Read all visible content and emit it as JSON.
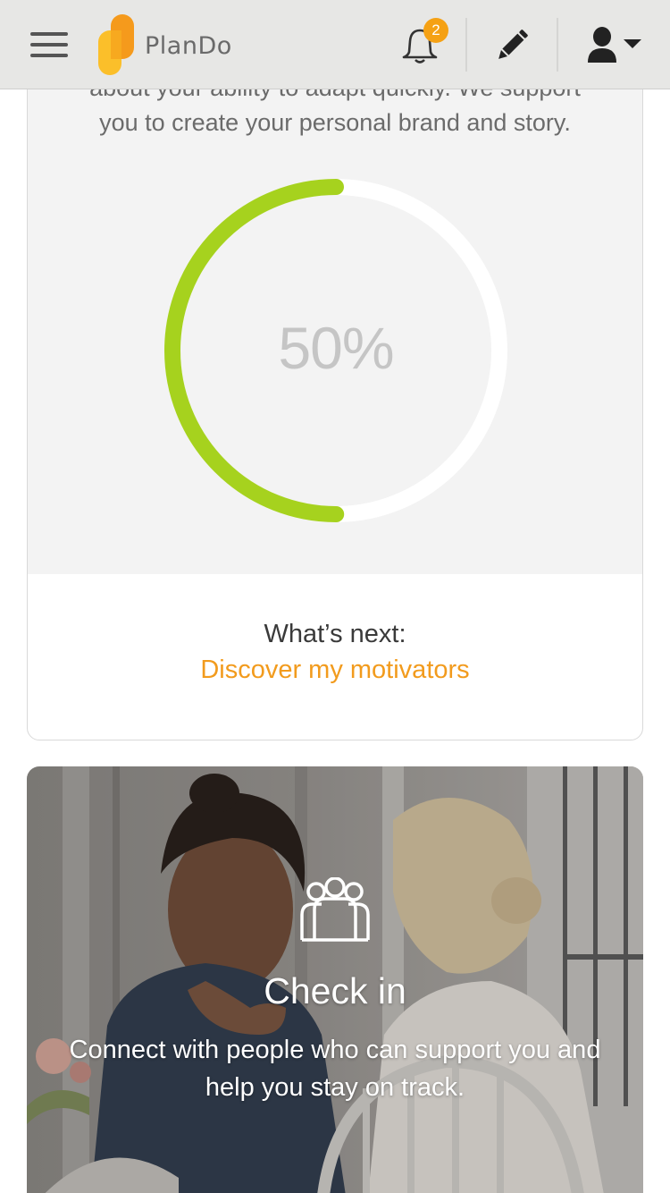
{
  "header": {
    "brand_name": "PlanDo",
    "notification_count": "2",
    "icons": {
      "menu": "hamburger-menu-icon",
      "logo": "plando-logo-icon",
      "notifications": "bell-icon",
      "edit": "pencil-icon",
      "profile": "user-icon",
      "profile_dropdown": "caret-down-icon"
    }
  },
  "progress_card": {
    "description_line_cut": "about your ability to adapt quickly. We support",
    "description_line": "you to create your personal brand and story.",
    "progress_value": 0.5,
    "progress_label": "50%",
    "next_label": "What’s next:",
    "next_link": "Discover my motivators"
  },
  "checkin_card": {
    "icon": "people-group-icon",
    "title": "Check in",
    "subtitle": "Connect with people who can support you and help you stay on track."
  },
  "colors": {
    "header_bg": "#e7e7e5",
    "accent_orange": "#f29b1d",
    "progress_green": "#a6d21e",
    "card_bg": "#f3f3f3"
  }
}
